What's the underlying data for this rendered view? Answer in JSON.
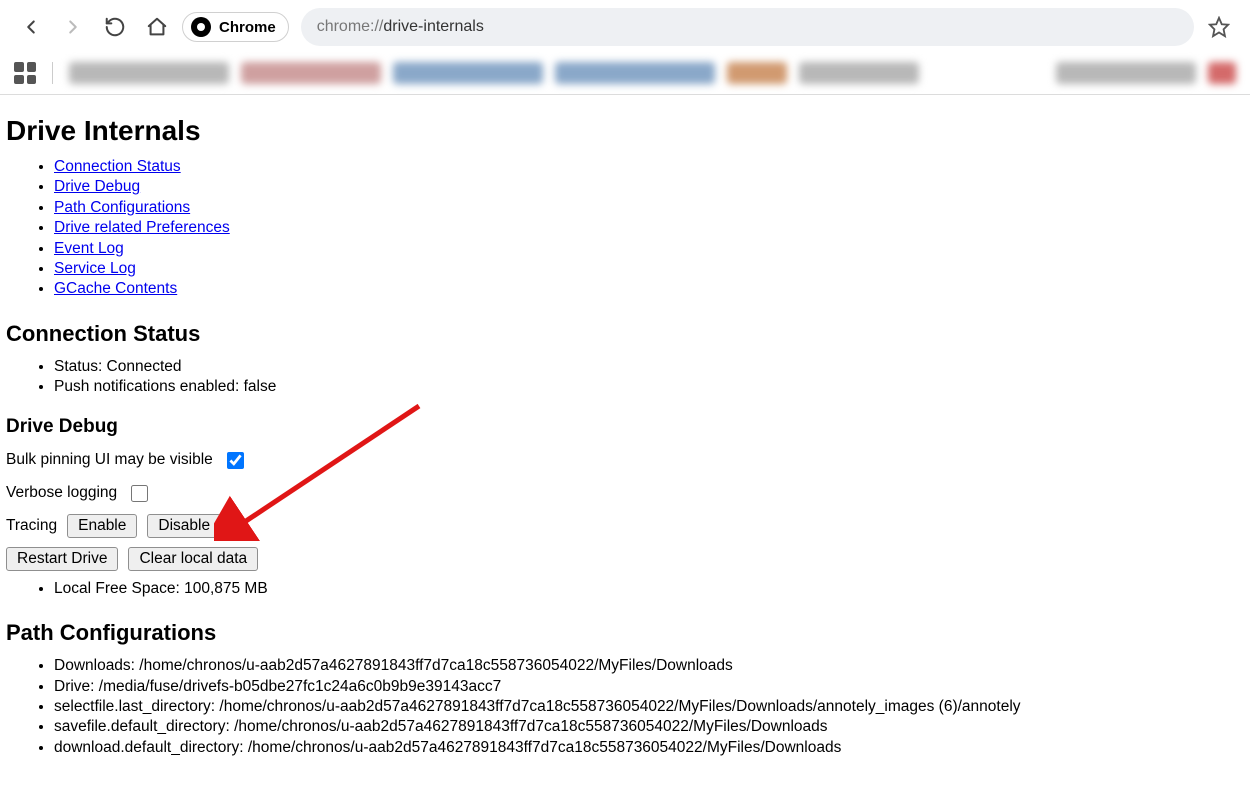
{
  "browser": {
    "chrome_pill_label": "Chrome",
    "url_protocol": "chrome://",
    "url_path": "drive-internals"
  },
  "page": {
    "title": "Drive Internals",
    "nav_links": [
      "Connection Status",
      "Drive Debug",
      "Path Configurations",
      "Drive related Preferences",
      "Event Log",
      "Service Log",
      "GCache Contents"
    ]
  },
  "connection_status": {
    "heading": "Connection Status",
    "items": [
      "Status: Connected",
      "Push notifications enabled: false"
    ]
  },
  "drive_debug": {
    "heading": "Drive Debug",
    "bulk_pinning_label": "Bulk pinning UI may be visible",
    "bulk_pinning_checked": true,
    "verbose_logging_label": "Verbose logging",
    "verbose_logging_checked": false,
    "tracing_label": "Tracing",
    "enable_label": "Enable",
    "disable_label": "Disable",
    "restart_label": "Restart Drive",
    "clear_label": "Clear local data",
    "free_space_item": "Local Free Space: 100,875 MB"
  },
  "path_configurations": {
    "heading": "Path Configurations",
    "items": [
      "Downloads: /home/chronos/u-aab2d57a4627891843ff7d7ca18c558736054022/MyFiles/Downloads",
      "Drive: /media/fuse/drivefs-b05dbe27fc1c24a6c0b9b9e39143acc7",
      "selectfile.last_directory: /home/chronos/u-aab2d57a4627891843ff7d7ca18c558736054022/MyFiles/Downloads/annotely_images (6)/annotely",
      "savefile.default_directory: /home/chronos/u-aab2d57a4627891843ff7d7ca18c558736054022/MyFiles/Downloads",
      "download.default_directory: /home/chronos/u-aab2d57a4627891843ff7d7ca18c558736054022/MyFiles/Downloads"
    ]
  }
}
